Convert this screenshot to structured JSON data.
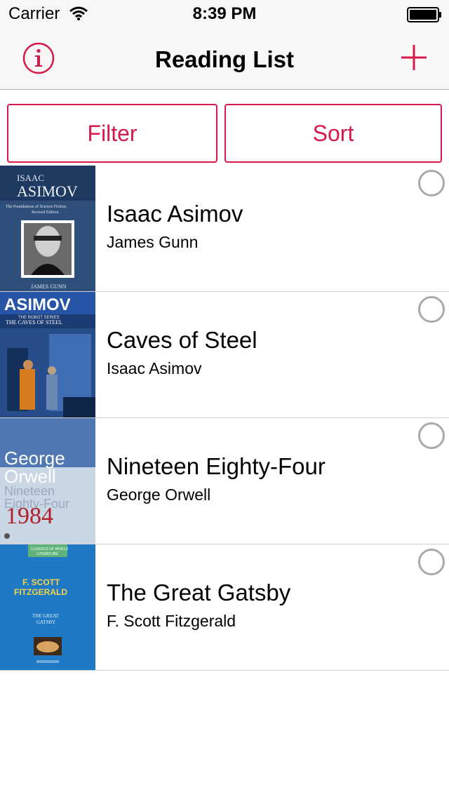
{
  "status_bar": {
    "carrier": "Carrier",
    "time": "8:39 PM",
    "icons": [
      "wifi-icon",
      "battery-icon"
    ]
  },
  "nav": {
    "title": "Reading List",
    "left_icon": "info-icon",
    "right_icon": "plus-icon",
    "accent": "#d7194a"
  },
  "toolbar": {
    "filter_label": "Filter",
    "sort_label": "Sort"
  },
  "books": [
    {
      "title": "Isaac Asimov",
      "author": "James Gunn",
      "cover_text": [
        "ISAAC",
        "ASIMOV",
        "The Foundations of Science Fiction,",
        "Revised Edition",
        "JAMES GUNN"
      ]
    },
    {
      "title": "Caves of Steel",
      "author": "Isaac Asimov",
      "cover_text": [
        "ASIMOV",
        "THE ROBOT SERIES",
        "THE CAVES OF STEEL"
      ]
    },
    {
      "title": "Nineteen Eighty-Four",
      "author": "George Orwell",
      "cover_text": [
        "George",
        "Orwell",
        "Nineteen",
        "Eighty-Four",
        "1984"
      ]
    },
    {
      "title": "The Great Gatsby",
      "author": "F. Scott Fitzgerald",
      "cover_text": [
        "CLASSICS OF WORLD",
        "LITERATURE",
        "F. SCOTT",
        "FITZGERALD",
        "THE GREAT",
        "GATSBY"
      ]
    }
  ]
}
